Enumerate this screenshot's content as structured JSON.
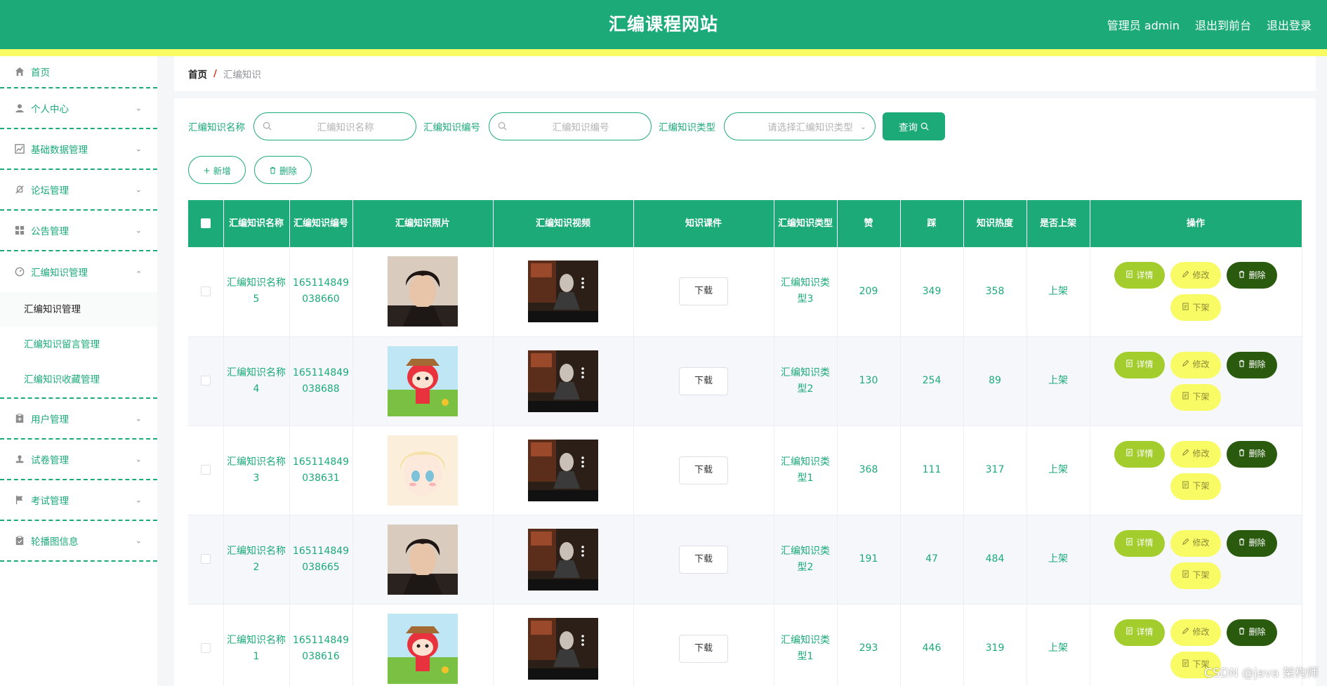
{
  "header": {
    "site_title": "汇编课程网站",
    "admin_label": "管理员 admin",
    "to_front": "退出到前台",
    "logout": "退出登录"
  },
  "sidebar": {
    "items": [
      {
        "label": "首页",
        "icon": "home-icon"
      },
      {
        "label": "个人中心",
        "icon": "user-icon"
      },
      {
        "label": "基础数据管理",
        "icon": "chart-icon"
      },
      {
        "label": "论坛管理",
        "icon": "bell-off-icon"
      },
      {
        "label": "公告管理",
        "icon": "grid-icon"
      },
      {
        "label": "汇编知识管理",
        "icon": "dashboard-icon"
      },
      {
        "label": "用户管理",
        "icon": "clipboard-icon"
      },
      {
        "label": "试卷管理",
        "icon": "stamp-icon"
      },
      {
        "label": "考试管理",
        "icon": "flag-icon"
      },
      {
        "label": "轮播图信息",
        "icon": "checklist-icon"
      }
    ],
    "sub_items": [
      "汇编知识管理",
      "汇编知识留言管理",
      "汇编知识收藏管理"
    ]
  },
  "breadcrumb": {
    "home": "首页",
    "separator": "/",
    "current": "汇编知识"
  },
  "search": {
    "name_label": "汇编知识名称",
    "name_placeholder": "汇编知识名称",
    "code_label": "汇编知识编号",
    "code_placeholder": "汇编知识编号",
    "type_label": "汇编知识类型",
    "type_placeholder": "请选择汇编知识类型",
    "query_button": "查询"
  },
  "actions": {
    "add": "新增",
    "delete": "删除"
  },
  "table": {
    "headers": [
      "汇编知识名称",
      "汇编知识编号",
      "汇编知识照片",
      "汇编知识视频",
      "知识课件",
      "汇编知识类型",
      "赞",
      "踩",
      "知识热度",
      "是否上架",
      "操作"
    ],
    "rows": [
      {
        "name": "汇编知识名称5",
        "code": "165114849038660",
        "photo": "avatar-man",
        "download": "下载",
        "type": "汇编知识类型3",
        "like": "209",
        "dislike": "349",
        "hot": "358",
        "status": "上架"
      },
      {
        "name": "汇编知识名称4",
        "code": "165114849038688",
        "photo": "avatar-cartoon",
        "download": "下载",
        "type": "汇编知识类型2",
        "like": "130",
        "dislike": "254",
        "hot": "89",
        "status": "上架"
      },
      {
        "name": "汇编知识名称3",
        "code": "165114849038631",
        "photo": "avatar-anime",
        "download": "下载",
        "type": "汇编知识类型1",
        "like": "368",
        "dislike": "111",
        "hot": "317",
        "status": "上架"
      },
      {
        "name": "汇编知识名称2",
        "code": "165114849038665",
        "photo": "avatar-man",
        "download": "下载",
        "type": "汇编知识类型2",
        "like": "191",
        "dislike": "47",
        "hot": "484",
        "status": "上架"
      },
      {
        "name": "汇编知识名称1",
        "code": "165114849038616",
        "photo": "avatar-cartoon",
        "download": "下载",
        "type": "汇编知识类型1",
        "like": "293",
        "dislike": "446",
        "hot": "319",
        "status": "上架"
      }
    ],
    "ops": {
      "detail": "详情",
      "edit": "修改",
      "delete": "删除",
      "off_shelf": "下架"
    }
  },
  "watermark": "CSDN @java 架构师",
  "colors": {
    "primary": "#1caa78",
    "accent_yellow": "#f9fb64",
    "detail_green": "#a3cd2d",
    "delete_dark": "#2a5a0e"
  }
}
